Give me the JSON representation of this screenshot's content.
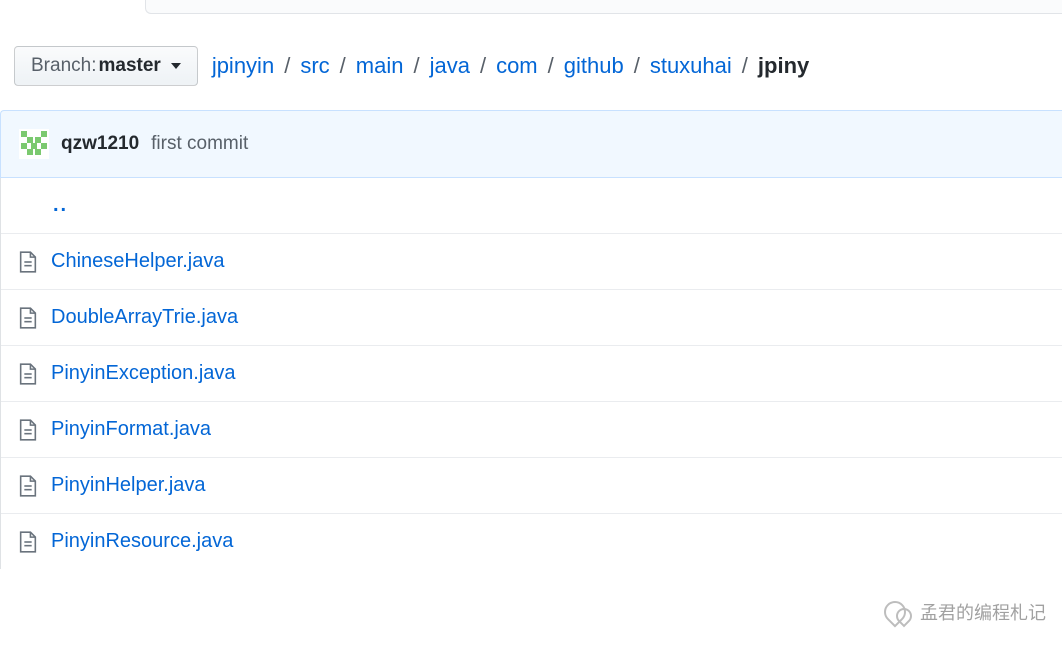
{
  "branch": {
    "label": "Branch:",
    "name": "master"
  },
  "breadcrumbs": {
    "parts": [
      "jpinyin",
      "src",
      "main",
      "java",
      "com",
      "github",
      "stuxuhai"
    ],
    "current": "jpiny"
  },
  "commit": {
    "author": "qzw1210",
    "message": "first commit"
  },
  "updir": "..",
  "files": [
    {
      "name": "ChineseHelper.java"
    },
    {
      "name": "DoubleArrayTrie.java"
    },
    {
      "name": "PinyinException.java"
    },
    {
      "name": "PinyinFormat.java"
    },
    {
      "name": "PinyinHelper.java"
    },
    {
      "name": "PinyinResource.java"
    }
  ],
  "watermark": "孟君的编程札记"
}
